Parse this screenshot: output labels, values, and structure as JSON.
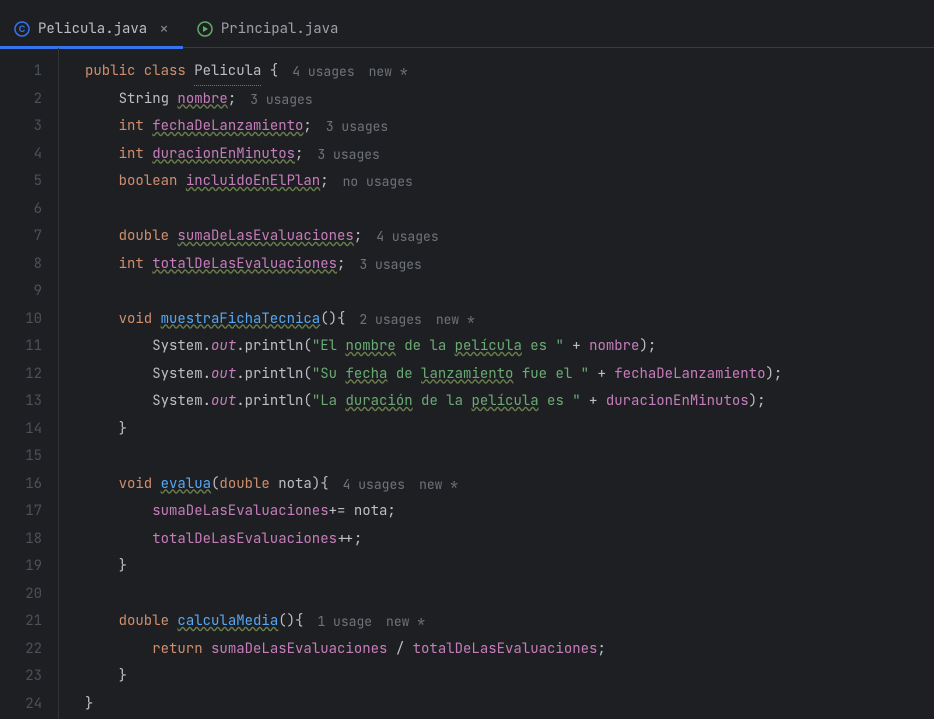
{
  "tabs": [
    {
      "name": "Pelicula.java",
      "active": true
    },
    {
      "name": "Principal.java",
      "active": false
    }
  ],
  "code": {
    "lines": [
      {
        "n": 1,
        "segments": [
          {
            "t": "public class ",
            "c": "kw"
          },
          {
            "t": "Pelicula",
            "c": "cls underline"
          },
          {
            "t": " {",
            "c": "punct"
          }
        ],
        "hints": [
          "4 usages",
          "new *"
        ]
      },
      {
        "n": 2,
        "indent": 1,
        "segments": [
          {
            "t": "String ",
            "c": "cls"
          },
          {
            "t": "nombre",
            "c": "field wavy"
          },
          {
            "t": ";",
            "c": "punct"
          }
        ],
        "hints": [
          "3 usages"
        ]
      },
      {
        "n": 3,
        "indent": 1,
        "segments": [
          {
            "t": "int ",
            "c": "kw"
          },
          {
            "t": "fechaDeLanzamiento",
            "c": "field wavy"
          },
          {
            "t": ";",
            "c": "punct"
          }
        ],
        "hints": [
          "3 usages"
        ]
      },
      {
        "n": 4,
        "indent": 1,
        "segments": [
          {
            "t": "int ",
            "c": "kw"
          },
          {
            "t": "duracionEnMinutos",
            "c": "field wavy"
          },
          {
            "t": ";",
            "c": "punct"
          }
        ],
        "hints": [
          "3 usages"
        ]
      },
      {
        "n": 5,
        "indent": 1,
        "segments": [
          {
            "t": "boolean ",
            "c": "kw"
          },
          {
            "t": "incluidoEnElPlan",
            "c": "field wavy"
          },
          {
            "t": ";",
            "c": "punct"
          }
        ],
        "hints": [
          "no usages"
        ]
      },
      {
        "n": 6,
        "segments": []
      },
      {
        "n": 7,
        "indent": 1,
        "segments": [
          {
            "t": "double ",
            "c": "kw"
          },
          {
            "t": "sumaDeLasEvaluaciones",
            "c": "field wavy"
          },
          {
            "t": ";",
            "c": "punct"
          }
        ],
        "hints": [
          "4 usages"
        ]
      },
      {
        "n": 8,
        "indent": 1,
        "segments": [
          {
            "t": "int ",
            "c": "kw"
          },
          {
            "t": "totalDeLasEvaluaciones",
            "c": "field wavy"
          },
          {
            "t": ";",
            "c": "punct"
          }
        ],
        "hints": [
          "3 usages"
        ]
      },
      {
        "n": 9,
        "segments": []
      },
      {
        "n": 10,
        "indent": 1,
        "segments": [
          {
            "t": "void ",
            "c": "kw"
          },
          {
            "t": "muestraFichaTecnica",
            "c": "method wavy"
          },
          {
            "t": "(){",
            "c": "punct"
          }
        ],
        "hints": [
          "2 usages",
          "new *"
        ]
      },
      {
        "n": 11,
        "indent": 2,
        "segments": [
          {
            "t": "System.",
            "c": "cls"
          },
          {
            "t": "out",
            "c": "static-field"
          },
          {
            "t": ".println(",
            "c": "cls"
          },
          {
            "t": "\"El ",
            "c": "str"
          },
          {
            "t": "nombre",
            "c": "str wavy"
          },
          {
            "t": " de la ",
            "c": "str"
          },
          {
            "t": "película",
            "c": "str wavy"
          },
          {
            "t": " es \"",
            "c": "str"
          },
          {
            "t": " + ",
            "c": "punct"
          },
          {
            "t": "nombre",
            "c": "field"
          },
          {
            "t": ");",
            "c": "punct"
          }
        ]
      },
      {
        "n": 12,
        "indent": 2,
        "segments": [
          {
            "t": "System.",
            "c": "cls"
          },
          {
            "t": "out",
            "c": "static-field"
          },
          {
            "t": ".println(",
            "c": "cls"
          },
          {
            "t": "\"Su ",
            "c": "str"
          },
          {
            "t": "fecha",
            "c": "str wavy"
          },
          {
            "t": " de ",
            "c": "str"
          },
          {
            "t": "lanzamiento",
            "c": "str wavy"
          },
          {
            "t": " fue el \"",
            "c": "str"
          },
          {
            "t": " + ",
            "c": "punct"
          },
          {
            "t": "fechaDeLanzamiento",
            "c": "field"
          },
          {
            "t": ");",
            "c": "punct"
          }
        ]
      },
      {
        "n": 13,
        "indent": 2,
        "segments": [
          {
            "t": "System.",
            "c": "cls"
          },
          {
            "t": "out",
            "c": "static-field"
          },
          {
            "t": ".println(",
            "c": "cls"
          },
          {
            "t": "\"La ",
            "c": "str"
          },
          {
            "t": "duración",
            "c": "str wavy"
          },
          {
            "t": " de la ",
            "c": "str"
          },
          {
            "t": "película",
            "c": "str wavy"
          },
          {
            "t": " es \"",
            "c": "str"
          },
          {
            "t": " + ",
            "c": "punct"
          },
          {
            "t": "duracionEnMinutos",
            "c": "field"
          },
          {
            "t": ");",
            "c": "punct"
          }
        ]
      },
      {
        "n": 14,
        "indent": 1,
        "segments": [
          {
            "t": "}",
            "c": "punct"
          }
        ]
      },
      {
        "n": 15,
        "segments": []
      },
      {
        "n": 16,
        "indent": 1,
        "segments": [
          {
            "t": "void ",
            "c": "kw"
          },
          {
            "t": "evalua",
            "c": "method wavy"
          },
          {
            "t": "(",
            "c": "punct"
          },
          {
            "t": "double ",
            "c": "kw"
          },
          {
            "t": "nota",
            "c": "cls"
          },
          {
            "t": "){",
            "c": "punct"
          }
        ],
        "hints": [
          "4 usages",
          "new *"
        ]
      },
      {
        "n": 17,
        "indent": 2,
        "segments": [
          {
            "t": "sumaDeLasEvaluaciones",
            "c": "field"
          },
          {
            "t": "+= ",
            "c": "punct"
          },
          {
            "t": "nota",
            "c": "cls"
          },
          {
            "t": ";",
            "c": "punct"
          }
        ]
      },
      {
        "n": 18,
        "indent": 2,
        "segments": [
          {
            "t": "totalDeLasEvaluaciones",
            "c": "field"
          },
          {
            "t": "++;",
            "c": "punct"
          }
        ]
      },
      {
        "n": 19,
        "indent": 1,
        "segments": [
          {
            "t": "}",
            "c": "punct"
          }
        ]
      },
      {
        "n": 20,
        "segments": []
      },
      {
        "n": 21,
        "indent": 1,
        "segments": [
          {
            "t": "double ",
            "c": "kw"
          },
          {
            "t": "calculaMedia",
            "c": "method wavy"
          },
          {
            "t": "(){",
            "c": "punct"
          }
        ],
        "hints": [
          "1 usage",
          "new *"
        ]
      },
      {
        "n": 22,
        "indent": 2,
        "segments": [
          {
            "t": "return ",
            "c": "kw"
          },
          {
            "t": "sumaDeLasEvaluaciones",
            "c": "field"
          },
          {
            "t": " / ",
            "c": "punct"
          },
          {
            "t": "totalDeLasEvaluaciones",
            "c": "field"
          },
          {
            "t": ";",
            "c": "punct"
          }
        ]
      },
      {
        "n": 23,
        "indent": 1,
        "segments": [
          {
            "t": "}",
            "c": "punct"
          }
        ]
      },
      {
        "n": 24,
        "segments": [
          {
            "t": "}",
            "c": "punct"
          }
        ]
      }
    ]
  }
}
